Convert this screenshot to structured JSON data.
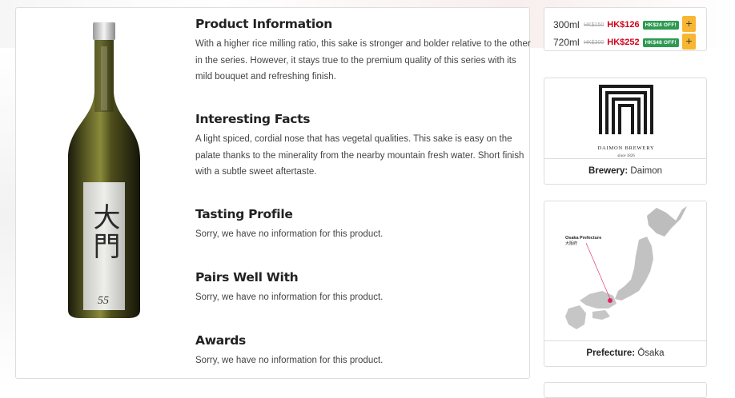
{
  "product": {
    "sections": [
      {
        "title": "Product Information",
        "body": "With a higher rice milling ratio, this sake is stronger and bolder relative to the other in the series. However, it stays true to the premium quality of this series with its mild bouquet and refreshing finish."
      },
      {
        "title": "Interesting Facts",
        "body": "A light spiced, cordial nose that has vegetal qualities. This sake is easy on the palate thanks to the minerality from the nearby mountain fresh water. Short finish with a subtle sweet aftertaste."
      },
      {
        "title": "Tasting Profile",
        "body": "Sorry, we have no information for this product."
      },
      {
        "title": "Pairs Well With",
        "body": "Sorry, we have no information for this product."
      },
      {
        "title": "Awards",
        "body": "Sorry, we have no information for this product."
      }
    ],
    "bottle_label": {
      "kanji": "大門",
      "number": "55"
    }
  },
  "pricing": {
    "options": [
      {
        "size": "300ml",
        "old_price": "HK$150",
        "price": "HK$126",
        "discount": "HK$24 OFF!",
        "add_label": "+"
      },
      {
        "size": "720ml",
        "old_price": "HK$300",
        "price": "HK$252",
        "discount": "HK$48 OFF!",
        "add_label": "+"
      }
    ]
  },
  "brewery": {
    "logo_name": "DAIMON BREWERY",
    "logo_since": "since 1826",
    "label": "Brewery:",
    "value": "Daimon"
  },
  "prefecture": {
    "map_label_en": "Osaka Prefecture",
    "map_label_jp": "大阪府",
    "label": "Prefecture:",
    "value": "Ōsaka"
  },
  "colors": {
    "price_red": "#d0021b",
    "badge_green": "#2e9a52",
    "add_button": "#f7b733",
    "map_marker": "#e0245e"
  }
}
